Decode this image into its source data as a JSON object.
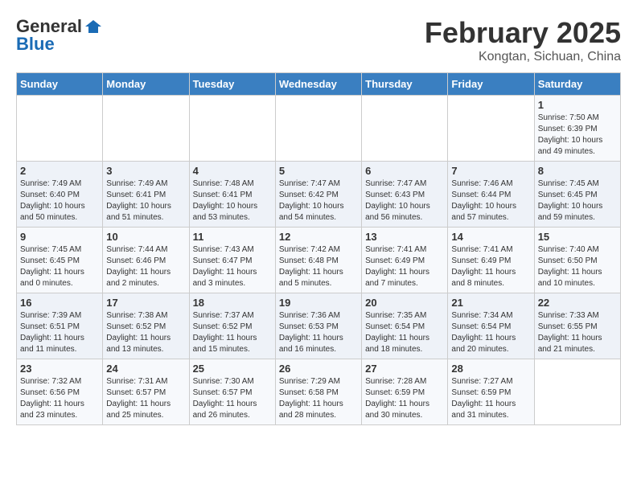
{
  "logo": {
    "general": "General",
    "blue": "Blue"
  },
  "header": {
    "month": "February 2025",
    "location": "Kongtan, Sichuan, China"
  },
  "weekdays": [
    "Sunday",
    "Monday",
    "Tuesday",
    "Wednesday",
    "Thursday",
    "Friday",
    "Saturday"
  ],
  "weeks": [
    [
      {
        "day": "",
        "info": ""
      },
      {
        "day": "",
        "info": ""
      },
      {
        "day": "",
        "info": ""
      },
      {
        "day": "",
        "info": ""
      },
      {
        "day": "",
        "info": ""
      },
      {
        "day": "",
        "info": ""
      },
      {
        "day": "1",
        "info": "Sunrise: 7:50 AM\nSunset: 6:39 PM\nDaylight: 10 hours and 49 minutes."
      }
    ],
    [
      {
        "day": "2",
        "info": "Sunrise: 7:49 AM\nSunset: 6:40 PM\nDaylight: 10 hours and 50 minutes."
      },
      {
        "day": "3",
        "info": "Sunrise: 7:49 AM\nSunset: 6:41 PM\nDaylight: 10 hours and 51 minutes."
      },
      {
        "day": "4",
        "info": "Sunrise: 7:48 AM\nSunset: 6:41 PM\nDaylight: 10 hours and 53 minutes."
      },
      {
        "day": "5",
        "info": "Sunrise: 7:47 AM\nSunset: 6:42 PM\nDaylight: 10 hours and 54 minutes."
      },
      {
        "day": "6",
        "info": "Sunrise: 7:47 AM\nSunset: 6:43 PM\nDaylight: 10 hours and 56 minutes."
      },
      {
        "day": "7",
        "info": "Sunrise: 7:46 AM\nSunset: 6:44 PM\nDaylight: 10 hours and 57 minutes."
      },
      {
        "day": "8",
        "info": "Sunrise: 7:45 AM\nSunset: 6:45 PM\nDaylight: 10 hours and 59 minutes."
      }
    ],
    [
      {
        "day": "9",
        "info": "Sunrise: 7:45 AM\nSunset: 6:45 PM\nDaylight: 11 hours and 0 minutes."
      },
      {
        "day": "10",
        "info": "Sunrise: 7:44 AM\nSunset: 6:46 PM\nDaylight: 11 hours and 2 minutes."
      },
      {
        "day": "11",
        "info": "Sunrise: 7:43 AM\nSunset: 6:47 PM\nDaylight: 11 hours and 3 minutes."
      },
      {
        "day": "12",
        "info": "Sunrise: 7:42 AM\nSunset: 6:48 PM\nDaylight: 11 hours and 5 minutes."
      },
      {
        "day": "13",
        "info": "Sunrise: 7:41 AM\nSunset: 6:49 PM\nDaylight: 11 hours and 7 minutes."
      },
      {
        "day": "14",
        "info": "Sunrise: 7:41 AM\nSunset: 6:49 PM\nDaylight: 11 hours and 8 minutes."
      },
      {
        "day": "15",
        "info": "Sunrise: 7:40 AM\nSunset: 6:50 PM\nDaylight: 11 hours and 10 minutes."
      }
    ],
    [
      {
        "day": "16",
        "info": "Sunrise: 7:39 AM\nSunset: 6:51 PM\nDaylight: 11 hours and 11 minutes."
      },
      {
        "day": "17",
        "info": "Sunrise: 7:38 AM\nSunset: 6:52 PM\nDaylight: 11 hours and 13 minutes."
      },
      {
        "day": "18",
        "info": "Sunrise: 7:37 AM\nSunset: 6:52 PM\nDaylight: 11 hours and 15 minutes."
      },
      {
        "day": "19",
        "info": "Sunrise: 7:36 AM\nSunset: 6:53 PM\nDaylight: 11 hours and 16 minutes."
      },
      {
        "day": "20",
        "info": "Sunrise: 7:35 AM\nSunset: 6:54 PM\nDaylight: 11 hours and 18 minutes."
      },
      {
        "day": "21",
        "info": "Sunrise: 7:34 AM\nSunset: 6:54 PM\nDaylight: 11 hours and 20 minutes."
      },
      {
        "day": "22",
        "info": "Sunrise: 7:33 AM\nSunset: 6:55 PM\nDaylight: 11 hours and 21 minutes."
      }
    ],
    [
      {
        "day": "23",
        "info": "Sunrise: 7:32 AM\nSunset: 6:56 PM\nDaylight: 11 hours and 23 minutes."
      },
      {
        "day": "24",
        "info": "Sunrise: 7:31 AM\nSunset: 6:57 PM\nDaylight: 11 hours and 25 minutes."
      },
      {
        "day": "25",
        "info": "Sunrise: 7:30 AM\nSunset: 6:57 PM\nDaylight: 11 hours and 26 minutes."
      },
      {
        "day": "26",
        "info": "Sunrise: 7:29 AM\nSunset: 6:58 PM\nDaylight: 11 hours and 28 minutes."
      },
      {
        "day": "27",
        "info": "Sunrise: 7:28 AM\nSunset: 6:59 PM\nDaylight: 11 hours and 30 minutes."
      },
      {
        "day": "28",
        "info": "Sunrise: 7:27 AM\nSunset: 6:59 PM\nDaylight: 11 hours and 31 minutes."
      },
      {
        "day": "",
        "info": ""
      }
    ]
  ]
}
